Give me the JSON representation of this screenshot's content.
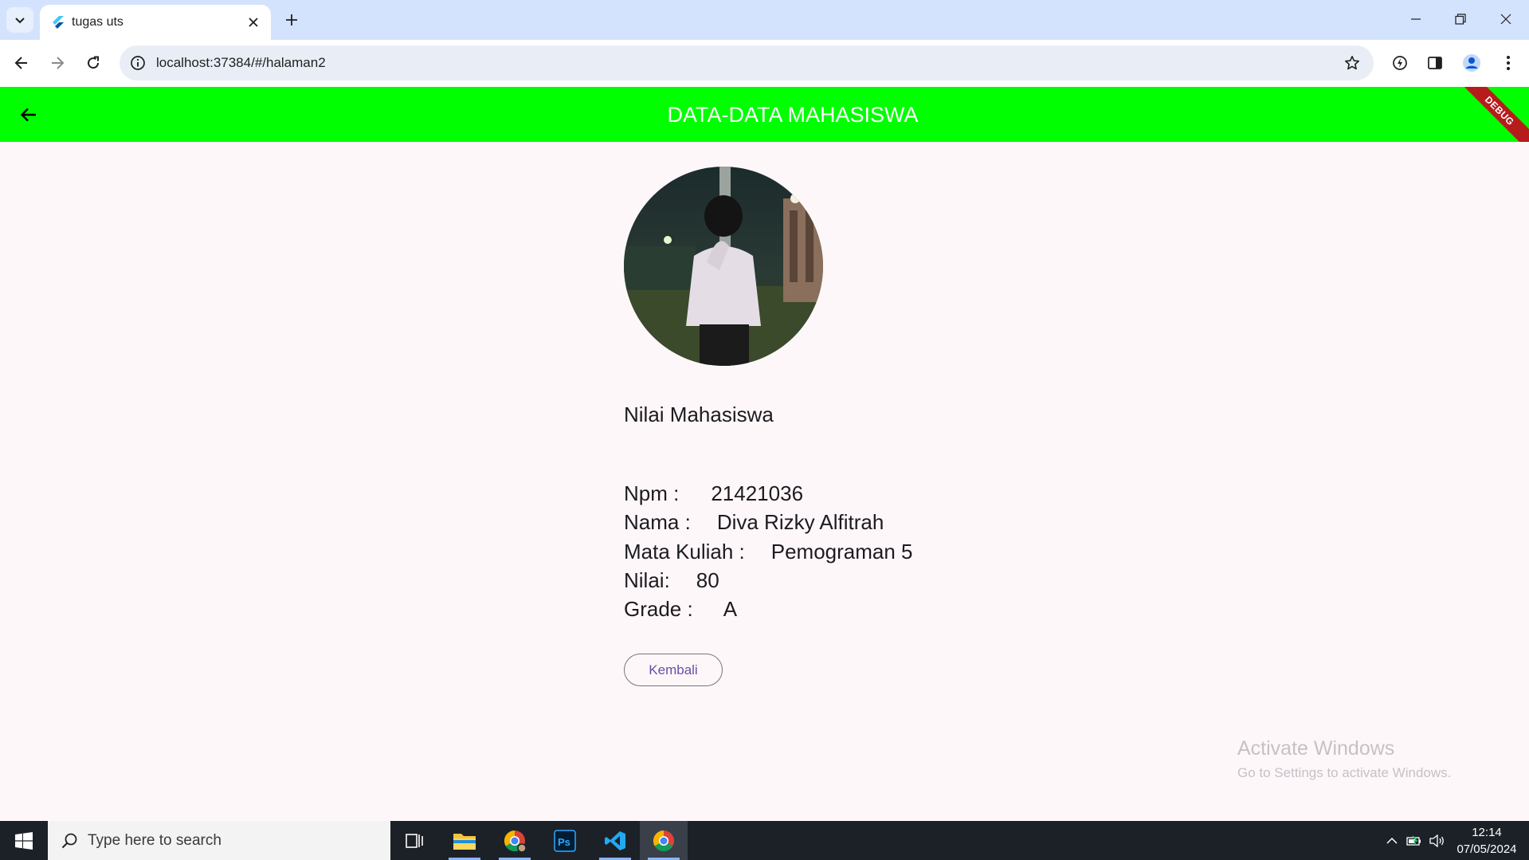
{
  "browser": {
    "tab_title": "tugas uts",
    "url": "localhost:37384/#/halaman2"
  },
  "appbar": {
    "title": "DATA-DATA MAHASISWA",
    "debug_label": "DEBUG",
    "color": "#00ff00"
  },
  "content": {
    "section_title": "Nilai Mahasiswa",
    "fields": [
      {
        "label": "Npm :",
        "value": "21421036"
      },
      {
        "label": "Nama :",
        "value": "Diva Rizky Alfitrah"
      },
      {
        "label": "Mata Kuliah :",
        "value": "Pemograman 5"
      },
      {
        "label": "Nilai:",
        "value": "80"
      },
      {
        "label": "Grade :",
        "value": "A"
      }
    ],
    "back_button_label": "Kembali",
    "avatar_icon": "student-photo"
  },
  "watermark": {
    "line1": "Activate Windows",
    "line2": "Go to Settings to activate Windows."
  },
  "taskbar": {
    "search_placeholder": "Type here to search",
    "time": "12:14",
    "date": "07/05/2024",
    "apps": [
      "task-view-icon",
      "file-explorer-icon",
      "chrome-profile-icon",
      "photoshop-icon",
      "vscode-icon",
      "chrome-icon"
    ]
  }
}
